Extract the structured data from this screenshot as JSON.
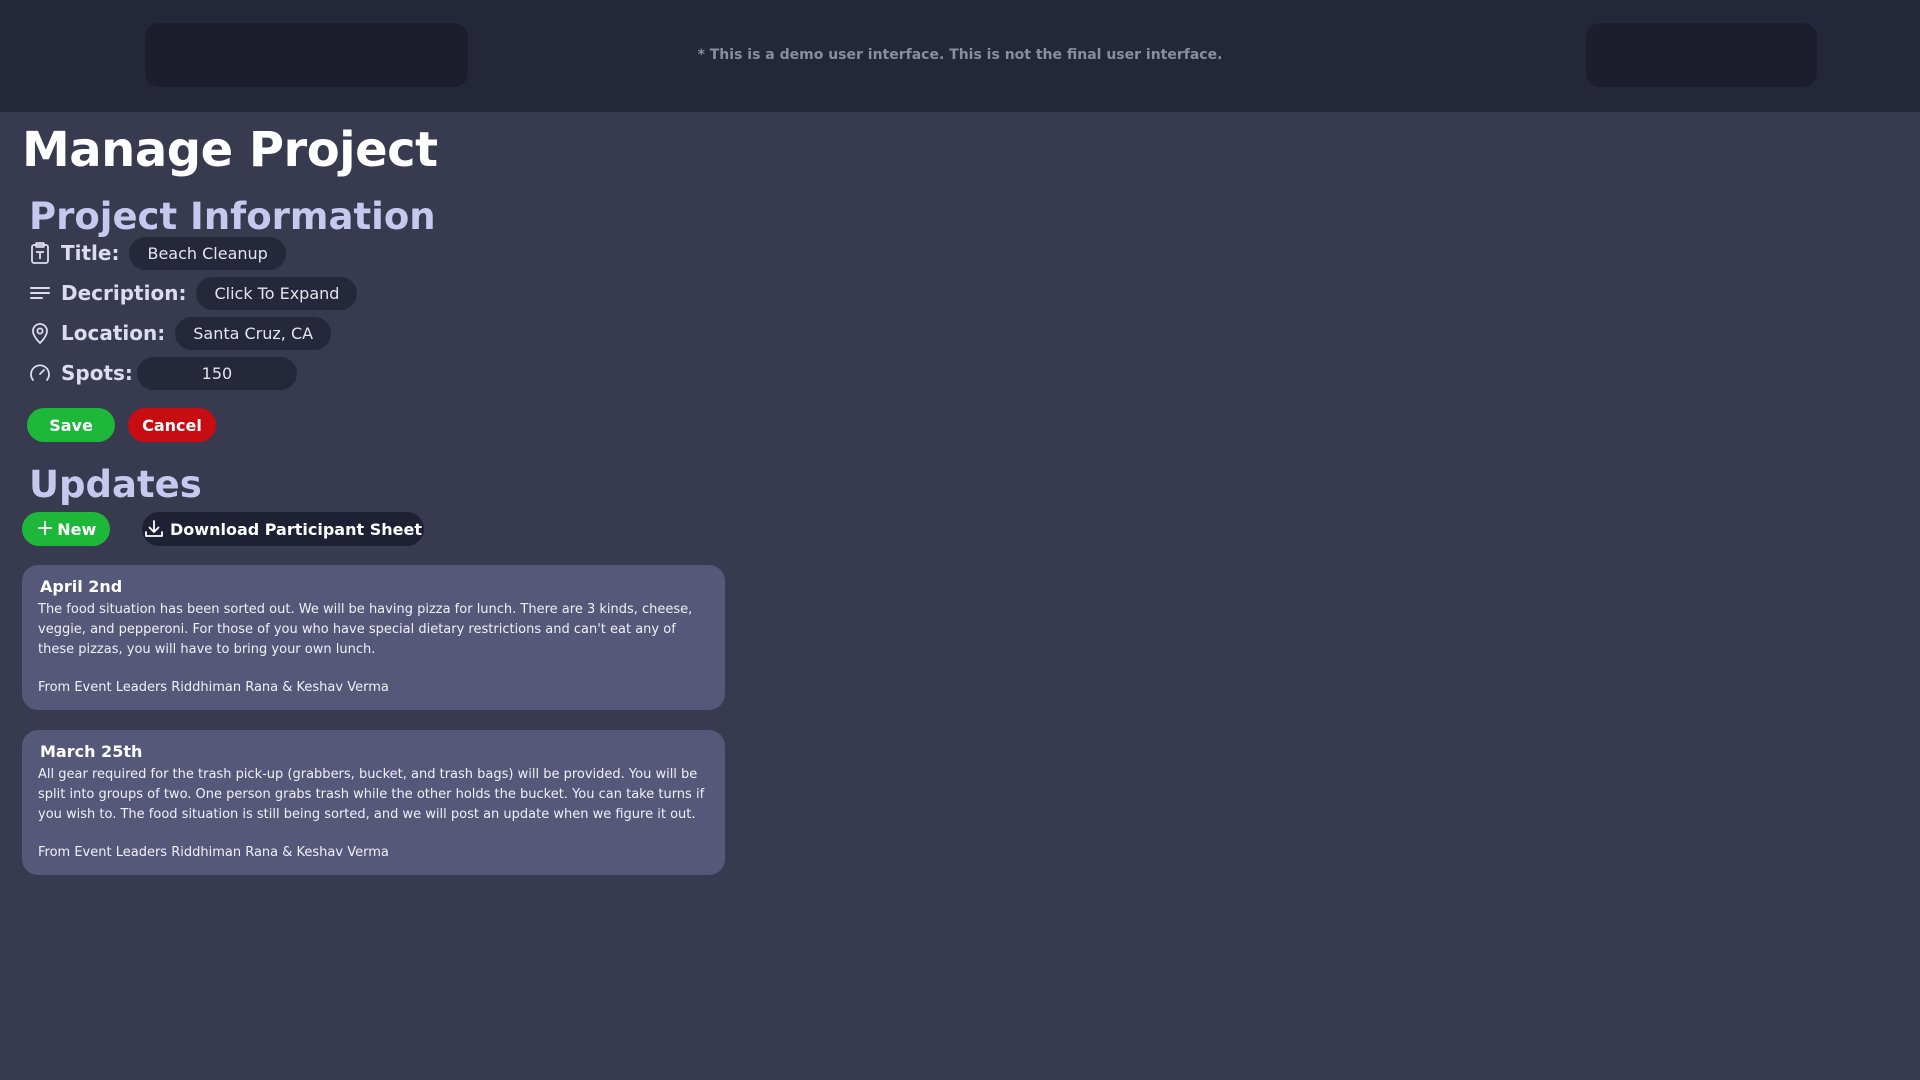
{
  "header": {
    "demo_note": "* This is a demo user interface. This is not the final user interface."
  },
  "page": {
    "title": "Manage Project"
  },
  "project_info": {
    "heading": "Project Information",
    "fields": [
      {
        "icon": "clipboard-icon",
        "label": "Title:",
        "value": "Beach Cleanup"
      },
      {
        "icon": "text-lines-icon",
        "label": "Decription:",
        "value": "Click To Expand"
      },
      {
        "icon": "location-pin-icon",
        "label": "Location:",
        "value": "Santa Cruz, CA"
      },
      {
        "icon": "gauge-icon",
        "label": "Spots:",
        "value": "150"
      }
    ],
    "save_label": "Save",
    "cancel_label": "Cancel"
  },
  "updates": {
    "heading": "Updates",
    "new_label": "New",
    "download_label": "Download Participant Sheet",
    "items": [
      {
        "date": "April 2nd",
        "body": "The food situation has been sorted out. We will be having pizza for lunch. There are 3 kinds, cheese, veggie, and pepperoni. For those of you who have special dietary restrictions and can't eat any of these pizzas, you will have to bring your own lunch.",
        "signature": "From Event Leaders Riddhiman Rana & Keshav Verma"
      },
      {
        "date": "March 25th",
        "body": "All gear required for the trash pick-up (grabbers, bucket, and trash bags) will be provided. You will be split into groups of two. One person grabs trash while the other holds the bucket. You can take turns if you wish to. The food situation is still being sorted, and we will post an update when we figure it out.",
        "signature": "From Event Leaders Riddhiman Rana & Keshav Verma"
      }
    ]
  },
  "colors": {
    "background": "#383a4f",
    "header": "#24263a",
    "accent_green": "#1db83a",
    "accent_red": "#c70d12",
    "heading_lavender": "#c6c8ee",
    "card": "#56587a"
  }
}
